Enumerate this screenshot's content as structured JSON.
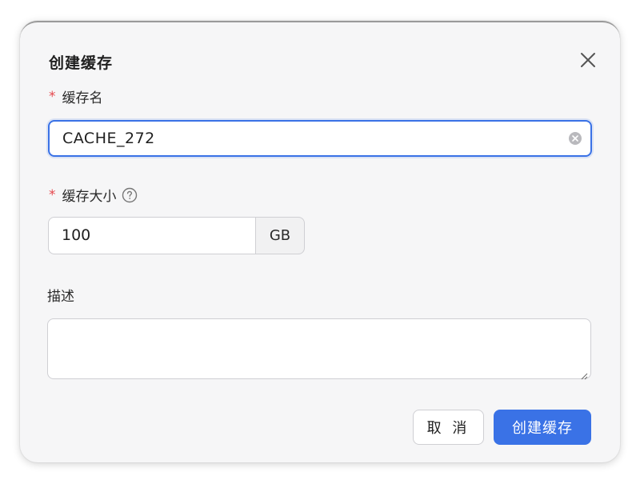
{
  "dialog": {
    "title": "创建缓存",
    "close_icon": "close-icon"
  },
  "form": {
    "name": {
      "required_mark": "*",
      "label": "缓存名",
      "value": "CACHE_272",
      "clear_icon": "clear-circle-icon"
    },
    "size": {
      "required_mark": "*",
      "label": "缓存大小",
      "help_icon": "question-circle-icon",
      "value": "100",
      "unit": "GB"
    },
    "description": {
      "label": "描述",
      "value": ""
    }
  },
  "actions": {
    "cancel_label": "取 消",
    "submit_label": "创建缓存"
  },
  "colors": {
    "primary": "#3a72e6",
    "required": "#e5484d",
    "dialog_bg": "#f6f6f7"
  }
}
